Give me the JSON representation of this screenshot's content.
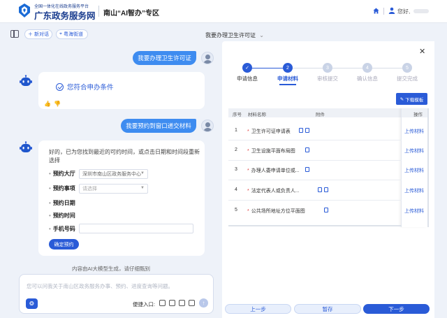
{
  "header": {
    "brand_sub": "全国一体化在线政务服务平台",
    "brand_main": "广东政务服务网",
    "zone_title": "南山“AI智办”专区",
    "greeting": "您好,"
  },
  "toolbar": {
    "new_chat": "新对话",
    "location": "粤海街道",
    "task_title": "我要办理卫生许可证"
  },
  "chat": {
    "msg1": "我要办理卫生许可证",
    "eligible": "您符合申办条件",
    "msg2": "我要预约到窗口递交材料",
    "intro": "好的，已为您找到最近的可约时间，或点击日期和时间段重新选择",
    "form": {
      "hall_label": "预约大厅",
      "hall_value": "深圳市南山区政务服务中心",
      "item_label": "预约事项",
      "item_placeholder": "请选择",
      "date_label": "预约日期",
      "time_label": "预约时间",
      "phone_label": "手机号码",
      "confirm": "确定预约"
    },
    "disclaimer": "内容由AI大模型生成，请仔细甄别",
    "input_placeholder": "您可以问我关于南山区政务服务办事、预约、进度查询等问题。",
    "quick_entry": "便捷入口:"
  },
  "panel": {
    "steps": [
      {
        "label": "申请信息",
        "num": "✓",
        "state": "done"
      },
      {
        "label": "申请材料",
        "num": "2",
        "state": "active"
      },
      {
        "label": "审核提交",
        "num": "3",
        "state": "todo"
      },
      {
        "label": "确认信息",
        "num": "4",
        "state": "todo"
      },
      {
        "label": "提交完成",
        "num": "5",
        "state": "todo"
      }
    ],
    "template_btn": "下载模板",
    "columns": {
      "no": "序号",
      "name": "材料名称",
      "attach": "附件",
      "op": "操作"
    },
    "rows": [
      {
        "no": "1",
        "name": "卫生许可证申请表",
        "upload": "上传材料"
      },
      {
        "no": "2",
        "name": "卫生设施平面布局图",
        "upload": "上传材料"
      },
      {
        "no": "3",
        "name": "办理人委申请单位或...",
        "upload": "上传材料"
      },
      {
        "no": "4",
        "name": "法定代表人或负责人...",
        "upload": "上传材料"
      },
      {
        "no": "5",
        "name": "公共场所地址方位平面图",
        "upload": "上传材料"
      }
    ],
    "prev": "上一步",
    "save": "暂存",
    "next": "下一步"
  }
}
